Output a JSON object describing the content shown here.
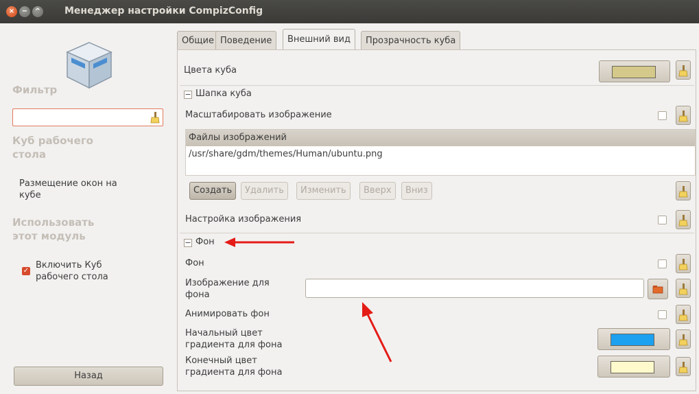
{
  "window": {
    "title": "Менеджер настройки CompizConfig"
  },
  "sidebar": {
    "filter_heading": "Фильтр",
    "filter_value": "",
    "plugin_heading_line1": "Куб рабочего",
    "plugin_heading_line2": "стола",
    "related_line1": "Размещение окон на",
    "related_line2": "кубе",
    "use_heading_line1": "Использовать",
    "use_heading_line2": "этот модуль",
    "enable_line1": "Включить Куб",
    "enable_line2": "рабочего стола",
    "enable_checked": true,
    "back_label": "Назад"
  },
  "tabs": [
    {
      "label": "Общие",
      "active": false
    },
    {
      "label": "Поведение",
      "active": false
    },
    {
      "label": "Внешний вид",
      "active": true
    },
    {
      "label": "Прозрачность куба",
      "active": false
    }
  ],
  "appearance": {
    "cube_color_label": "Цвета куба",
    "cube_color": "#d4c98a",
    "cap_section": "Шапка куба",
    "scale_image_label": "Масштабировать изображение",
    "scale_image_checked": false,
    "image_files_header": "Файлы изображений",
    "image_files": [
      "/usr/share/gdm/themes/Human/ubuntu.png"
    ],
    "buttons": {
      "create": "Создать",
      "delete": "Удалить",
      "edit": "Изменить",
      "up": "Вверх",
      "down": "Вниз"
    },
    "image_setup_label": "Настройка изображения",
    "image_setup_checked": false,
    "background_section": "Фон",
    "background_label": "Фон",
    "background_checked": false,
    "bg_image_label_line1": "Изображение для",
    "bg_image_label_line2": "фона",
    "bg_image_value": "",
    "animate_bg_label": "Анимировать фон",
    "animate_bg_checked": false,
    "gradient_start_line1": "Начальный цвет",
    "gradient_start_line2": "градиента для фона",
    "gradient_start_color": "#1ca0f0",
    "gradient_end_line1": "Конечный цвет",
    "gradient_end_line2": "градиента для фона",
    "gradient_end_color": "#fffacc"
  },
  "annotations": {
    "arrow_color": "#e41b17"
  }
}
